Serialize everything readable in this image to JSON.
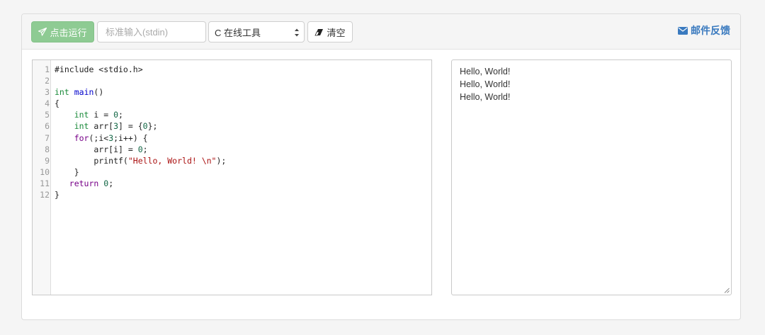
{
  "toolbar": {
    "run_label": "点击运行",
    "stdin_placeholder": "标准输入(stdin)",
    "stdin_value": "",
    "language_selected": "C 在线工具",
    "clear_label": "清空",
    "feedback_label": "邮件反馈"
  },
  "icons": {
    "run": "paper-plane-icon",
    "clear": "eraser-icon",
    "feedback": "envelope-icon",
    "select": "select-arrows-icon"
  },
  "colors": {
    "run_button_bg": "#8ecb93",
    "feedback_link": "#3a7abf",
    "keyword_type": "#1a8a3a",
    "keyword_def": "#0000cc",
    "keyword_ctrl": "#770088",
    "number": "#116644",
    "string": "#aa1111"
  },
  "editor": {
    "lines": [
      {
        "n": "1",
        "tokens": [
          {
            "t": "#include <stdio.h>",
            "c": ""
          }
        ]
      },
      {
        "n": "2",
        "tokens": []
      },
      {
        "n": "3",
        "tokens": [
          {
            "t": "int",
            "c": "kw-type"
          },
          {
            "t": " ",
            "c": ""
          },
          {
            "t": "main",
            "c": "kw-def"
          },
          {
            "t": "()",
            "c": ""
          }
        ]
      },
      {
        "n": "4",
        "tokens": [
          {
            "t": "{",
            "c": ""
          }
        ]
      },
      {
        "n": "5",
        "tokens": [
          {
            "t": "    ",
            "c": ""
          },
          {
            "t": "int",
            "c": "kw-type"
          },
          {
            "t": " i = ",
            "c": ""
          },
          {
            "t": "0",
            "c": "num"
          },
          {
            "t": ";",
            "c": ""
          }
        ]
      },
      {
        "n": "6",
        "tokens": [
          {
            "t": "    ",
            "c": ""
          },
          {
            "t": "int",
            "c": "kw-type"
          },
          {
            "t": " arr[",
            "c": ""
          },
          {
            "t": "3",
            "c": "num"
          },
          {
            "t": "] = {",
            "c": ""
          },
          {
            "t": "0",
            "c": "num"
          },
          {
            "t": "};",
            "c": ""
          }
        ]
      },
      {
        "n": "7",
        "tokens": [
          {
            "t": "    ",
            "c": ""
          },
          {
            "t": "for",
            "c": "kw-ctrl"
          },
          {
            "t": "(;i<",
            "c": ""
          },
          {
            "t": "3",
            "c": "num"
          },
          {
            "t": ";i++) {",
            "c": ""
          }
        ]
      },
      {
        "n": "8",
        "tokens": [
          {
            "t": "        arr[i] = ",
            "c": ""
          },
          {
            "t": "0",
            "c": "num"
          },
          {
            "t": ";",
            "c": ""
          }
        ]
      },
      {
        "n": "9",
        "tokens": [
          {
            "t": "        printf(",
            "c": ""
          },
          {
            "t": "\"Hello, World! \\n\"",
            "c": "str"
          },
          {
            "t": ");",
            "c": ""
          }
        ]
      },
      {
        "n": "10",
        "tokens": [
          {
            "t": "    }",
            "c": ""
          }
        ]
      },
      {
        "n": "11",
        "tokens": [
          {
            "t": "   ",
            "c": ""
          },
          {
            "t": "return",
            "c": "kw-ctrl"
          },
          {
            "t": " ",
            "c": ""
          },
          {
            "t": "0",
            "c": "num"
          },
          {
            "t": ";",
            "c": ""
          }
        ]
      },
      {
        "n": "12",
        "tokens": [
          {
            "t": "}",
            "c": ""
          }
        ]
      }
    ]
  },
  "output": {
    "lines": [
      "Hello, World!",
      "Hello, World!",
      "Hello, World!"
    ]
  }
}
